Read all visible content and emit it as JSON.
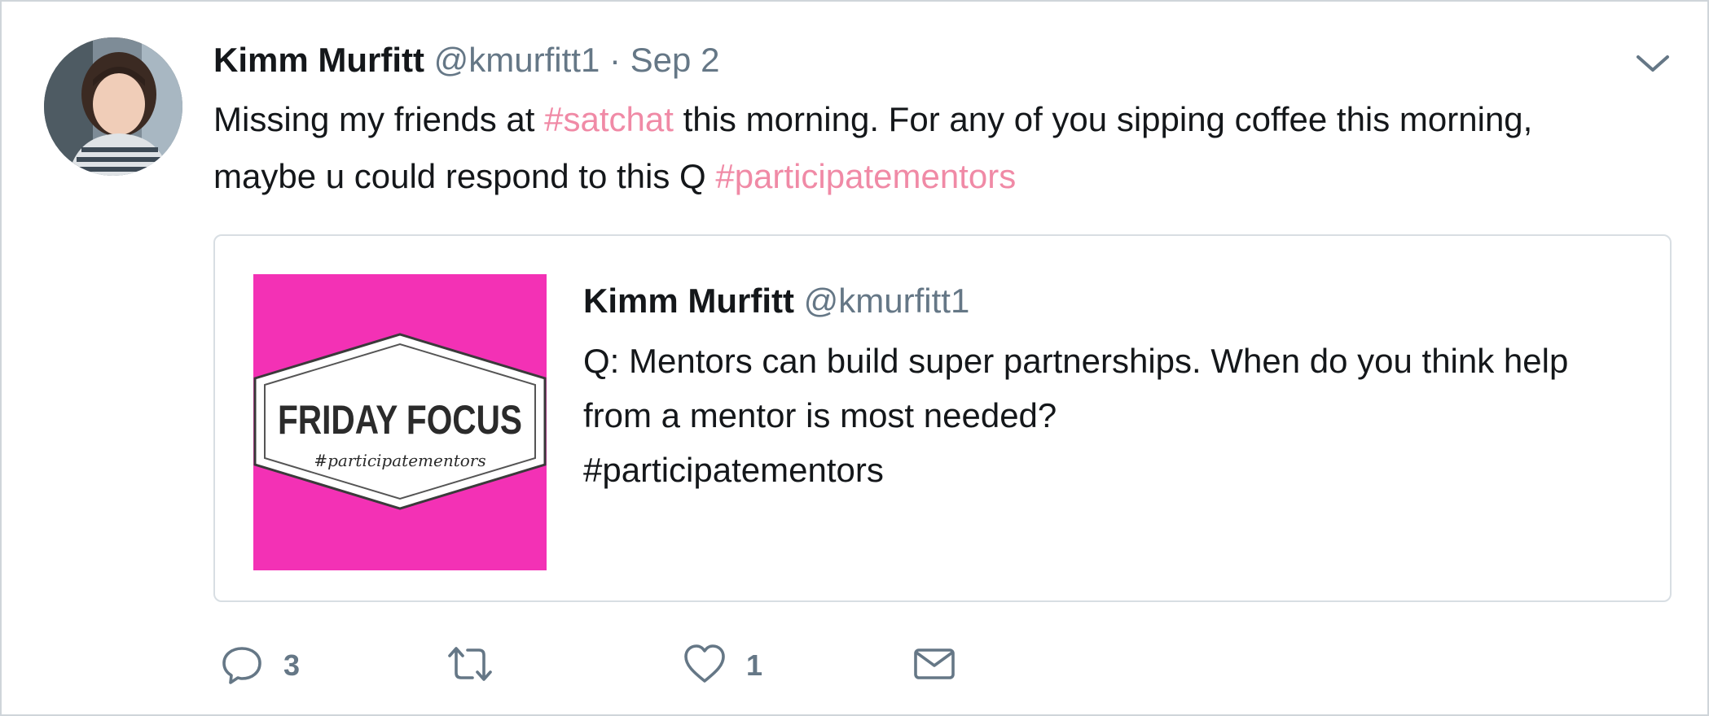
{
  "tweet": {
    "author_name": "Kimm Murfitt",
    "author_handle": "@kmurfitt1",
    "separator": "·",
    "date": "Sep 2",
    "text_parts": [
      {
        "text": "Missing my friends at ",
        "hashtag": false
      },
      {
        "text": "#satchat",
        "hashtag": true
      },
      {
        "text": " this morning. For any of you sipping coffee this morning, maybe u could respond to this Q ",
        "hashtag": false
      },
      {
        "text": "#participatementors",
        "hashtag": true
      }
    ],
    "hashtag_color": "#f08aa6"
  },
  "quoted_tweet": {
    "author_name": "Kimm Murfitt",
    "author_handle": "@kmurfitt1",
    "text_line1": "Q:  Mentors can build super partnerships.  When do you think help from a mentor is most needed?",
    "text_line2": "#participatementors",
    "image": {
      "title": "FRIDAY FOCUS",
      "subtitle": "#participatementors",
      "background_color": "#f331b5"
    }
  },
  "actions": {
    "reply_icon": "reply-icon",
    "reply_count": "3",
    "retweet_icon": "retweet-icon",
    "like_icon": "heart-icon",
    "like_count": "1",
    "message_icon": "envelope-icon"
  },
  "menu_icon": "chevron-down-icon"
}
